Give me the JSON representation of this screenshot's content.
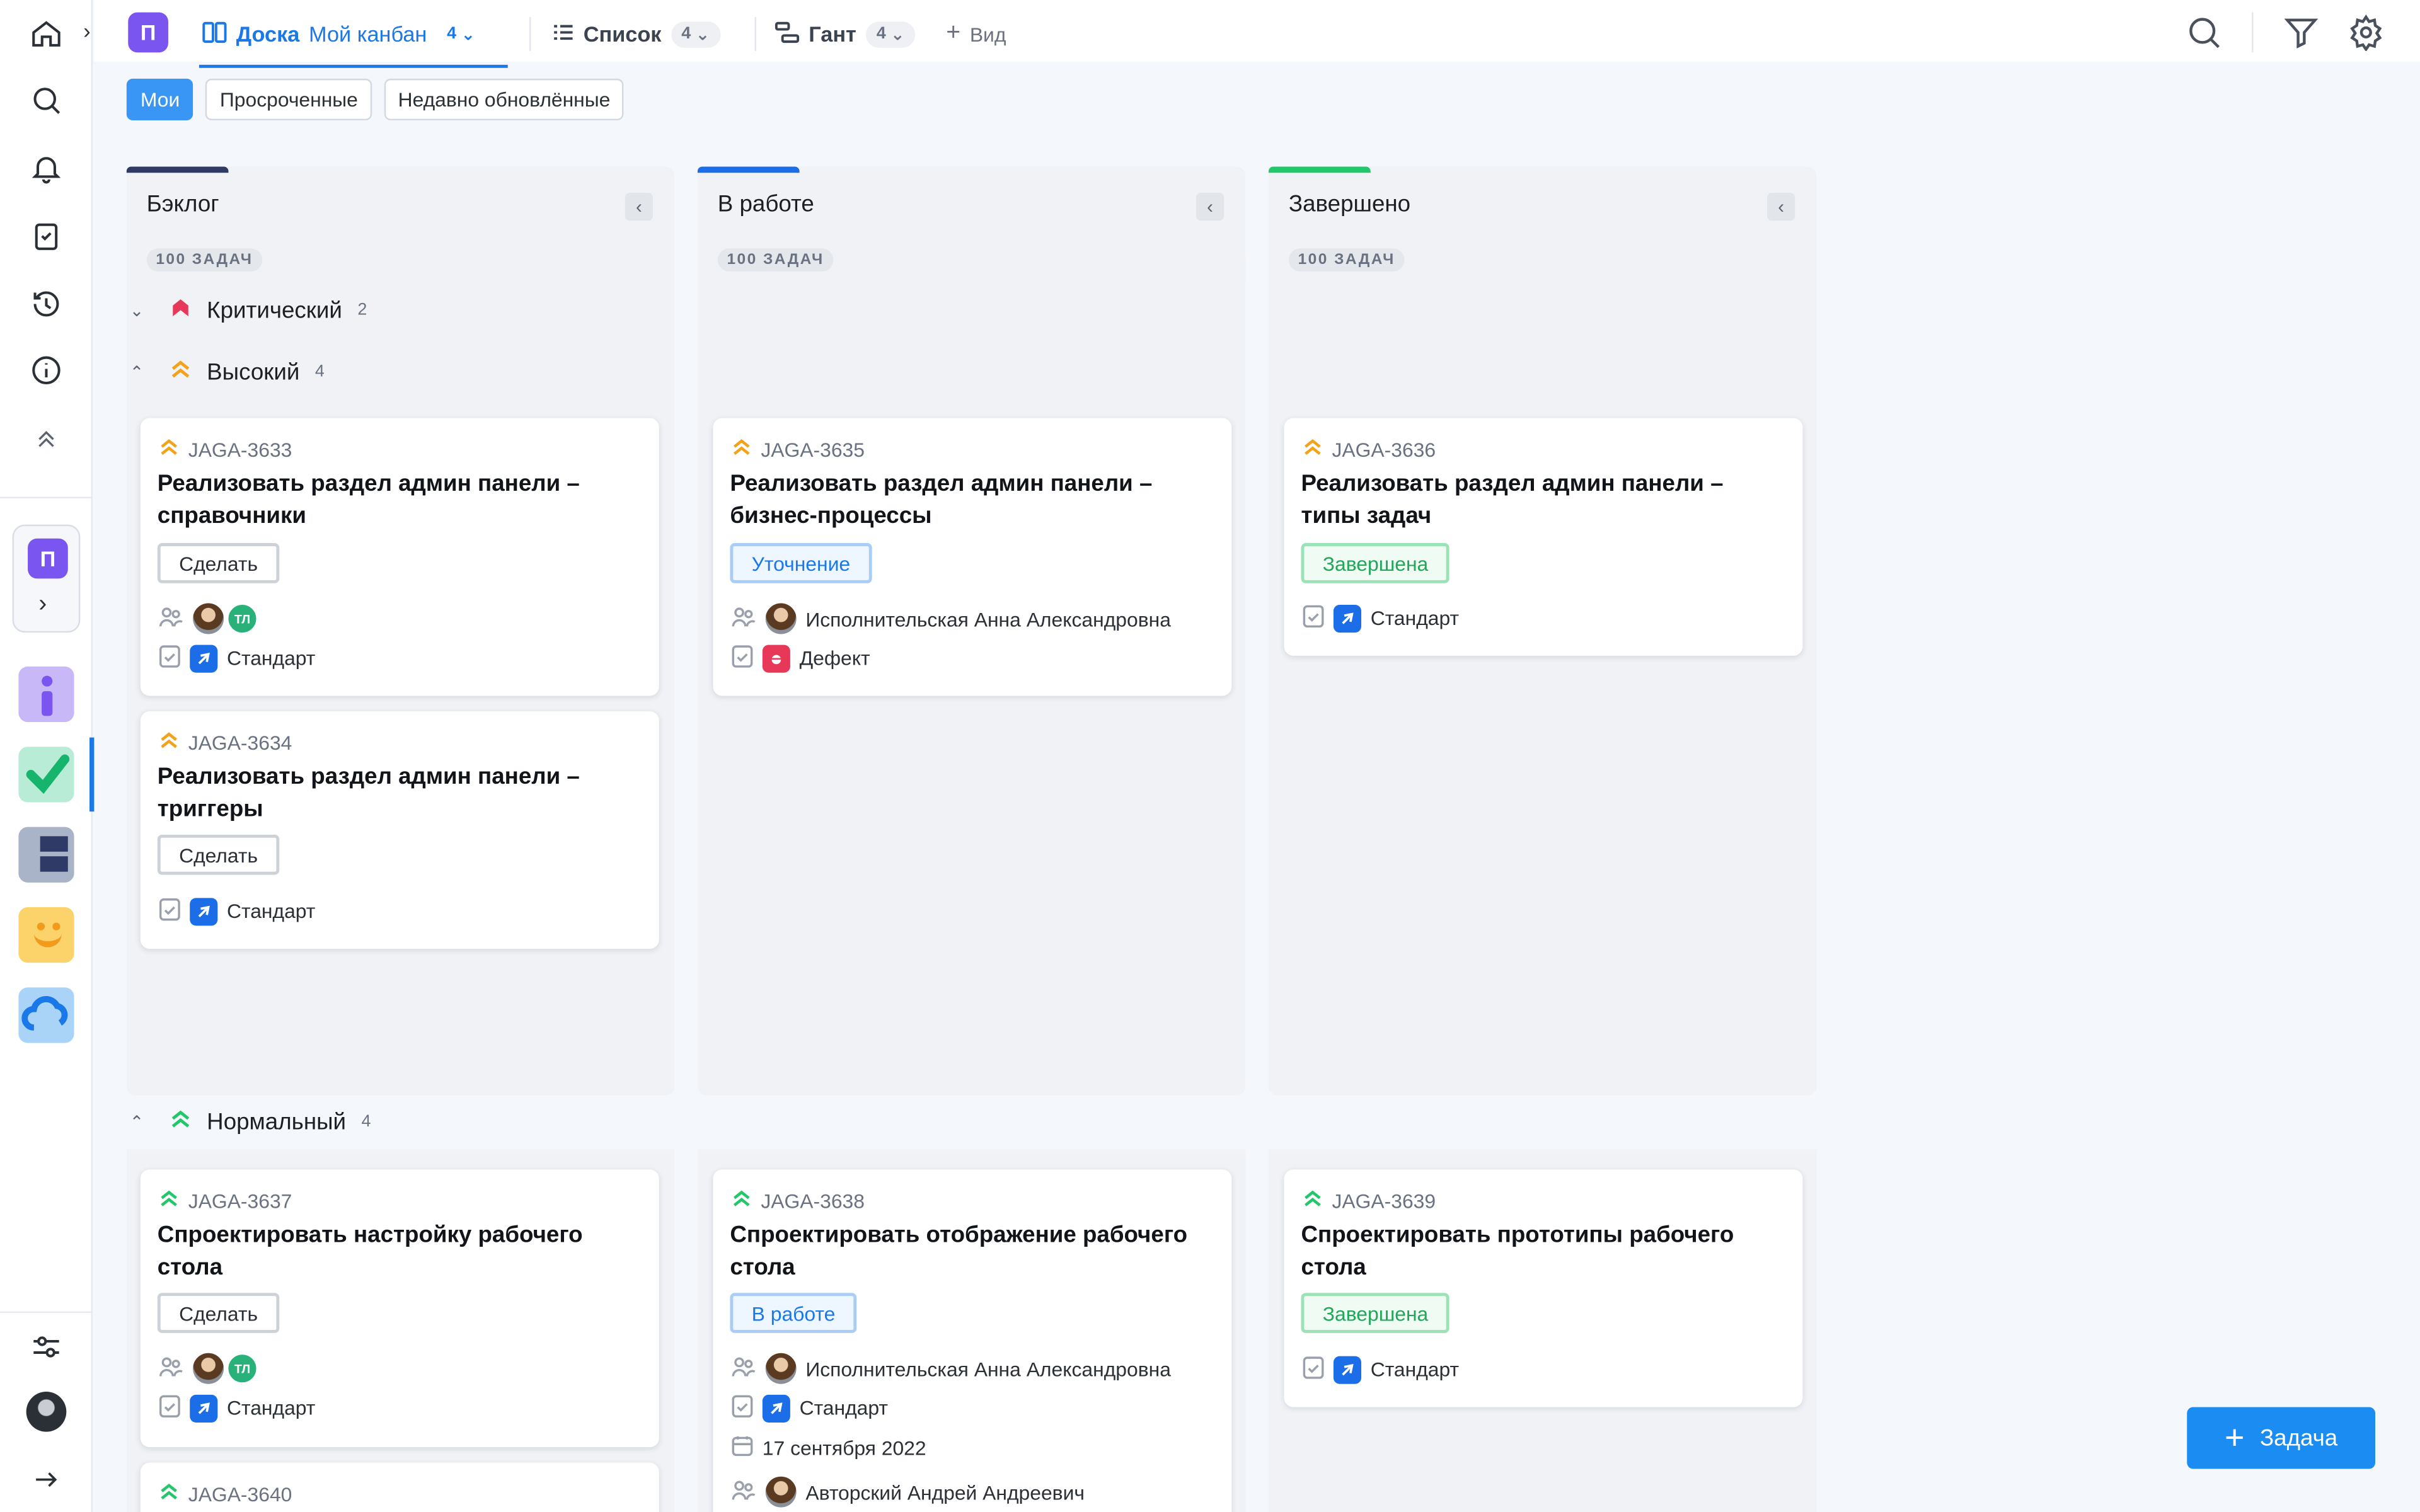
{
  "project_badge": "П",
  "tabs": [
    {
      "label": "Доска",
      "sub": "Мой канбан",
      "count": "4"
    },
    {
      "label": "Список",
      "count": "4"
    },
    {
      "label": "Гант",
      "count": "4"
    }
  ],
  "add_view_label": "Вид",
  "filters": [
    "Мои",
    "Просроченные",
    "Недавно обновлённые"
  ],
  "columns": [
    {
      "title": "Бэклог",
      "count": "100 ЗАДАЧ",
      "accent": "#2f3b66"
    },
    {
      "title": "В работе",
      "count": "100 ЗАДАЧ",
      "accent": "#1b6ee8"
    },
    {
      "title": "Завершено",
      "count": "100 ЗАДАЧ",
      "accent": "#22c76a"
    }
  ],
  "groups": [
    {
      "label": "Критический",
      "count": "2"
    },
    {
      "label": "Высокий",
      "count": "4"
    },
    {
      "label": "Нормальный",
      "count": "4"
    }
  ],
  "cards": [
    {
      "key": "JAGA-3633",
      "title": "Реализовать раздел админ панели – справочники",
      "status": "Сделать",
      "assignee_initials": "ТЛ",
      "type": "Стандарт"
    },
    {
      "key": "JAGA-3634",
      "title": "Реализовать раздел админ панели – триггеры",
      "status": "Сделать",
      "type": "Стандарт"
    },
    {
      "key": "JAGA-3635",
      "title": "Реализовать раздел админ панели – бизнес-процессы",
      "status": "Уточнение",
      "assignee": "Исполнительская Анна Александровна",
      "type": "Дефект"
    },
    {
      "key": "JAGA-3636",
      "title": "Реализовать раздел админ панели – типы задач",
      "status": "Завершена",
      "type": "Стандарт"
    },
    {
      "key": "JAGA-3637",
      "title": "Спроектировать настройку рабочего стола",
      "status": "Сделать",
      "assignee_initials": "ТЛ",
      "type": "Стандарт"
    },
    {
      "key": "JAGA-3638",
      "title": "Спроектировать отображение рабочего стола",
      "status": "В работе",
      "assignee": "Исполнительская Анна Александровна",
      "type": "Стандарт",
      "date": "17 сентября 2022",
      "author": "Авторский Андрей Андреевич"
    },
    {
      "key": "JAGA-3639",
      "title": "Спроектировать прототипы рабочего стола",
      "status": "Завершена",
      "type": "Стандарт"
    },
    {
      "key": "JAGA-3640"
    }
  ],
  "fab_label": "Задача"
}
